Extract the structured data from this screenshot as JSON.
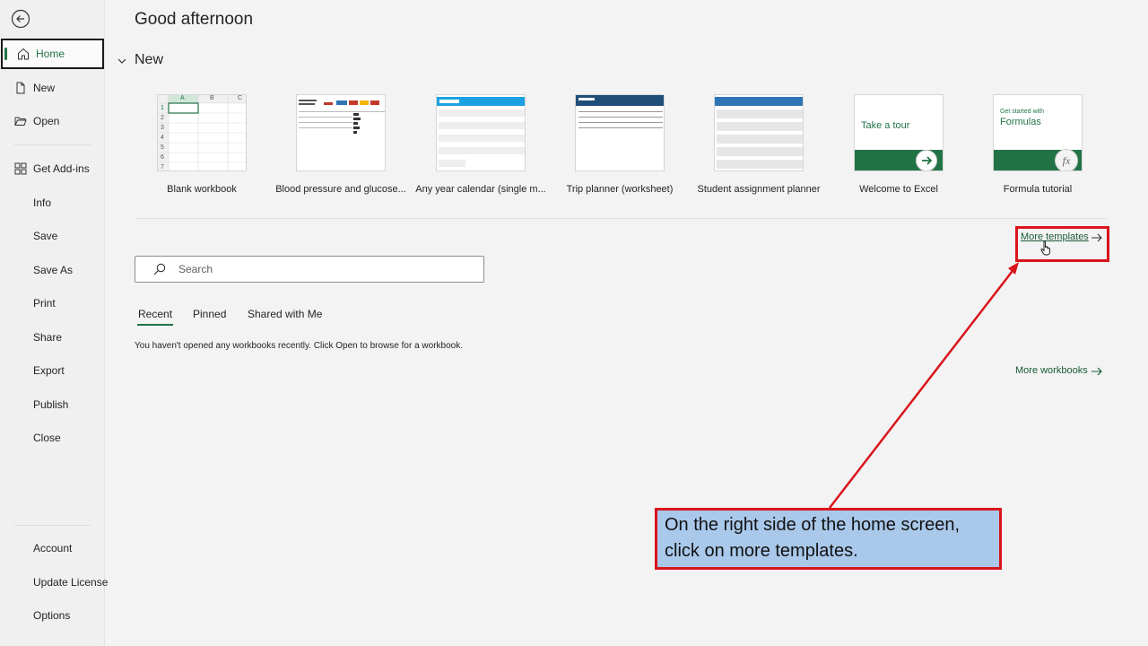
{
  "sidebar": {
    "back_icon": "back-arrow-icon",
    "items": [
      {
        "label": "Home",
        "icon": "home-icon"
      },
      {
        "label": "New",
        "icon": "new-file-icon"
      },
      {
        "label": "Open",
        "icon": "open-folder-icon"
      },
      {
        "label": "Get Add-ins",
        "icon": "grid-icon"
      },
      {
        "label": "Info"
      },
      {
        "label": "Save"
      },
      {
        "label": "Save As"
      },
      {
        "label": "Print"
      },
      {
        "label": "Share"
      },
      {
        "label": "Export"
      },
      {
        "label": "Publish"
      },
      {
        "label": "Close"
      }
    ],
    "bottom_items": [
      {
        "label": "Account"
      },
      {
        "label": "Update License"
      },
      {
        "label": "Options"
      }
    ]
  },
  "main": {
    "greeting": "Good afternoon",
    "new_heading": "New",
    "templates": [
      {
        "label": "Blank workbook"
      },
      {
        "label": "Blood pressure and glucose..."
      },
      {
        "label": "Any year calendar (single m..."
      },
      {
        "label": "Trip planner (worksheet)"
      },
      {
        "label": "Student assignment planner"
      },
      {
        "label": "Welcome to Excel",
        "thumb_text": "Take a tour"
      },
      {
        "label": "Formula tutorial",
        "thumb_small": "Get started with",
        "thumb_big": "Formulas",
        "fx": "fx"
      }
    ],
    "blank_columns": [
      "A",
      "B",
      "C"
    ],
    "blank_rows": [
      "1",
      "2",
      "3",
      "4",
      "5",
      "6",
      "7"
    ],
    "more_templates": "More templates",
    "search_placeholder": "Search",
    "tabs": [
      "Recent",
      "Pinned",
      "Shared with Me"
    ],
    "empty_message": "You haven't opened any workbooks recently. Click Open to browse for a workbook.",
    "more_workbooks": "More workbooks"
  },
  "callout": {
    "line1": "On the right side of the home screen,",
    "line2": "click on more templates."
  },
  "colors": {
    "accent": "#217346",
    "link": "#185c37",
    "highlight": "#d9141b",
    "callout_bg": "#a9c8ea"
  }
}
